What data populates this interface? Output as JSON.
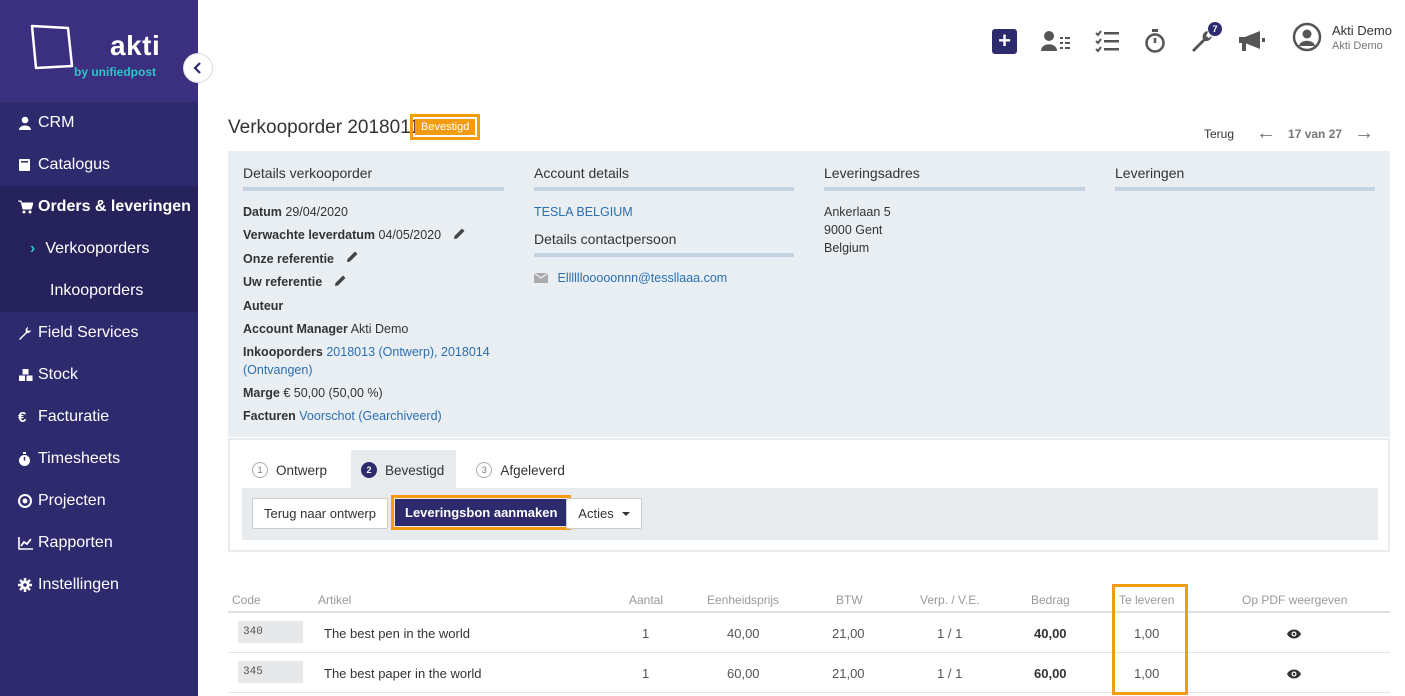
{
  "brand": {
    "name": "akti",
    "sub": "by unifiedpost"
  },
  "sidebar": {
    "items": [
      {
        "label": "CRM",
        "icon": "user-icon"
      },
      {
        "label": "Catalogus",
        "icon": "book-icon"
      },
      {
        "label": "Orders & leveringen",
        "icon": "cart-icon"
      },
      {
        "label": "Verkooporders",
        "icon": "chevron-right-icon"
      },
      {
        "label": "Inkooporders",
        "icon": ""
      },
      {
        "label": "Field Services",
        "icon": "wrench-icon"
      },
      {
        "label": "Stock",
        "icon": "cubes-icon"
      },
      {
        "label": "Facturatie",
        "icon": "euro-icon"
      },
      {
        "label": "Timesheets",
        "icon": "stopwatch-icon"
      },
      {
        "label": "Projecten",
        "icon": "target-icon"
      },
      {
        "label": "Rapporten",
        "icon": "chart-icon"
      },
      {
        "label": "Instellingen",
        "icon": "gear-icon"
      }
    ]
  },
  "topbar": {
    "notifications_badge": "7",
    "user_name": "Akti Demo",
    "user_company": "Akti Demo"
  },
  "header": {
    "title": "Verkooporder 2018011",
    "status": "Bevestigd",
    "back": "Terug",
    "pager": "17 van 27"
  },
  "details": {
    "order": {
      "heading": "Details verkooporder",
      "datum_label": "Datum",
      "datum_value": "29/04/2020",
      "verwacht_label": "Verwachte leverdatum",
      "verwacht_value": "04/05/2020",
      "onze_ref_label": "Onze referentie",
      "uw_ref_label": "Uw referentie",
      "auteur_label": "Auteur",
      "manager_label": "Account Manager",
      "manager_value": "Akti Demo",
      "inkoop_label": "Inkooporders",
      "inkoop_value_1": "2018013 (Ontwerp), 2018014",
      "inkoop_value_2": "(Ontvangen)",
      "marge_label": "Marge",
      "marge_value": "€ 50,00 (50,00 %)",
      "facturen_label": "Facturen",
      "facturen_value": "Voorschot (Gearchiveerd)"
    },
    "account": {
      "heading": "Account details",
      "name": "TESLA BELGIUM",
      "contact_heading": "Details contactpersoon",
      "email": "Ellllllooooonnn@tessllaaa.com"
    },
    "address": {
      "heading": "Leveringsadres",
      "line1": "Ankerlaan 5",
      "line2": "9000 Gent",
      "line3": "Belgium"
    },
    "deliveries": {
      "heading": "Leveringen"
    }
  },
  "workflow": {
    "steps": [
      {
        "num": "1",
        "label": "Ontwerp"
      },
      {
        "num": "2",
        "label": "Bevestigd"
      },
      {
        "num": "3",
        "label": "Afgeleverd"
      }
    ],
    "btn_back": "Terug naar ontwerp",
    "btn_create": "Leveringsbon aanmaken",
    "btn_actions": "Acties"
  },
  "table": {
    "headers": {
      "code": "Code",
      "artikel": "Artikel",
      "aantal": "Aantal",
      "eenheidsprijs": "Eenheidsprijs",
      "btw": "BTW",
      "verp": "Verp. / V.E.",
      "bedrag": "Bedrag",
      "te_leveren": "Te leveren",
      "pdf": "Op PDF weergeven"
    },
    "rows": [
      {
        "code": "340",
        "artikel": "The best pen in the world",
        "aantal": "1",
        "prijs": "40,00",
        "btw": "21,00",
        "verp": "1 / 1",
        "bedrag": "40,00",
        "te_leveren": "1,00"
      },
      {
        "code": "345",
        "artikel": "The best paper in the world",
        "aantal": "1",
        "prijs": "60,00",
        "btw": "21,00",
        "verp": "1 / 1",
        "bedrag": "60,00",
        "te_leveren": "1,00"
      }
    ]
  },
  "colors": {
    "brand": "#2e2a6e",
    "accent": "#f39c12",
    "teal": "#2ec4c9",
    "link": "#2a6fb0"
  }
}
